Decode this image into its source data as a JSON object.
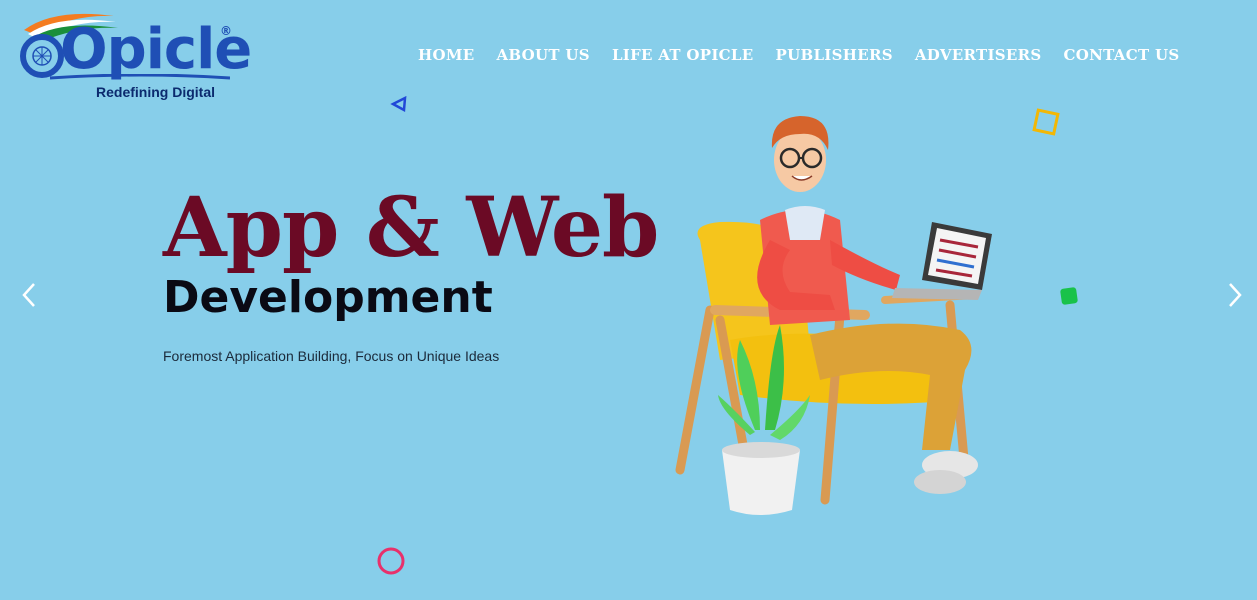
{
  "brand": {
    "name": "Opicle",
    "registered": "®",
    "tagline": "Redefining Digital",
    "colors": {
      "primary": "#1f4fb5",
      "saffron": "#f47c20",
      "green": "#1a8f3a"
    }
  },
  "nav": {
    "items": [
      {
        "label": "HOME"
      },
      {
        "label": "ABOUT US"
      },
      {
        "label": "LIFE AT OPICLE"
      },
      {
        "label": "PUBLISHERS"
      },
      {
        "label": "ADVERTISERS"
      },
      {
        "label": "CONTACT US"
      }
    ]
  },
  "hero": {
    "title": "App & Web",
    "subtitle": "Development",
    "description": "Foremost Application Building, Focus on Unique Ideas",
    "colors": {
      "background": "#87ceea",
      "title": "#6b0a25",
      "subtitle": "#0a0a14"
    }
  },
  "slider": {
    "prev_icon": "chevron-left-icon",
    "next_icon": "chevron-right-icon"
  },
  "illustration": {
    "name": "developer-on-chair-illustration"
  }
}
